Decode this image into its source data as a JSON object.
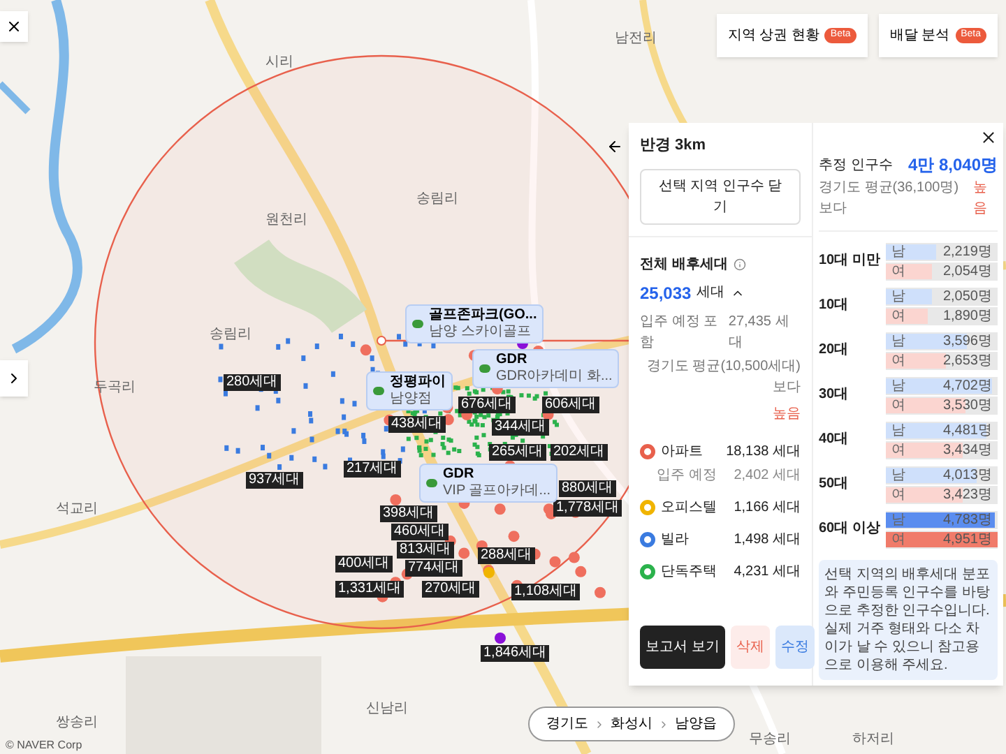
{
  "top_buttons": [
    {
      "label": "지역 상권 현황",
      "badge": "Beta"
    },
    {
      "label": "배달 분석",
      "badge": "Beta"
    }
  ],
  "map": {
    "places": [
      "시리",
      "남전리",
      "송림리",
      "원천리",
      "송림리",
      "두곡리",
      "석교리",
      "쌍송리",
      "신남리",
      "무송리",
      "하저리"
    ],
    "household_labels": [
      "280세대",
      "937세대",
      "438세대",
      "676세대",
      "606세대",
      "344세대",
      "265세대",
      "202세대",
      "217세대",
      "880세대",
      "1,778세대",
      "398세대",
      "460세대",
      "813세대",
      "774세대",
      "288세대",
      "400세대",
      "1,331세대",
      "270세대",
      "1,108세대",
      "1,846세대"
    ],
    "poi_callouts": [
      {
        "title": "골프존파크(GO...",
        "subtitle": "남양 스카이골프"
      },
      {
        "title": "GDR",
        "subtitle": "GDR아카데미 화..."
      },
      {
        "title": "GDR",
        "subtitle": "VIP 골프아카데..."
      },
      {
        "title": "정평파이",
        "subtitle": "남양점"
      }
    ],
    "copyright": "© NAVER Corp"
  },
  "breadcrumb": [
    "경기도",
    "화성시",
    "남양읍"
  ],
  "panel": {
    "radius": "반경 3km",
    "close_population": "선택 지역 인구수 닫기",
    "total": {
      "label": "전체 배후세대",
      "value": "25,033",
      "unit": "세대",
      "expanded": true,
      "incl_label": "입주 예정 포함",
      "incl_value": "27,435 세대",
      "compare": "경기도 평균(10,500세대) 보다",
      "compare_result": "높음"
    },
    "types": [
      {
        "label": "아파트",
        "value": "18,138 세대",
        "color": "#e8604c",
        "sub_label": "입주 예정",
        "sub_value": "2,402 세대"
      },
      {
        "label": "오피스텔",
        "value": "1,166 세대",
        "color": "#f0b400"
      },
      {
        "label": "빌라",
        "value": "1,498 세대",
        "color": "#3a7be0"
      },
      {
        "label": "단독주택",
        "value": "4,231 세대",
        "color": "#2bb24c"
      }
    ],
    "actions": [
      "보고서 보기",
      "삭제",
      "수정"
    ],
    "population": {
      "label": "추정 인구수",
      "value": "4만 8,040명",
      "compare": "경기도 평균(36,100명) 보다",
      "compare_result": "높음"
    },
    "age_groups": [
      {
        "label": "10대 미만",
        "male": {
          "label": "남",
          "value": "2,219명",
          "level": 0.45
        },
        "female": {
          "label": "여",
          "value": "2,054명",
          "level": 0.41
        }
      },
      {
        "label": "10대",
        "male": {
          "label": "남",
          "value": "2,050명",
          "level": 0.41
        },
        "female": {
          "label": "여",
          "value": "1,890명",
          "level": 0.38
        }
      },
      {
        "label": "20대",
        "male": {
          "label": "남",
          "value": "3,596명",
          "level": 0.73
        },
        "female": {
          "label": "여",
          "value": "2,653명",
          "level": 0.54
        }
      },
      {
        "label": "30대",
        "male": {
          "label": "남",
          "value": "4,702명",
          "level": 0.95
        },
        "female": {
          "label": "여",
          "value": "3,530명",
          "level": 0.71
        }
      },
      {
        "label": "40대",
        "male": {
          "label": "남",
          "value": "4,481명",
          "level": 0.9
        },
        "female": {
          "label": "여",
          "value": "3,434명",
          "level": 0.69
        }
      },
      {
        "label": "50대",
        "male": {
          "label": "남",
          "value": "4,013명",
          "level": 0.81
        },
        "female": {
          "label": "여",
          "value": "3,423명",
          "level": 0.69
        }
      },
      {
        "label": "60대 이상",
        "male": {
          "label": "남",
          "value": "4,783명",
          "level": 0.97
        },
        "female": {
          "label": "여",
          "value": "4,951명",
          "level": 1.0
        }
      }
    ],
    "note": "선택 지역의 배후세대 분포와 주민등록 인구수를 바탕으로 추정한 인구수입니다. 실제 거주 형태와 다소 차이가 날 수 있으니 참고용으로 이용해 주세요."
  }
}
